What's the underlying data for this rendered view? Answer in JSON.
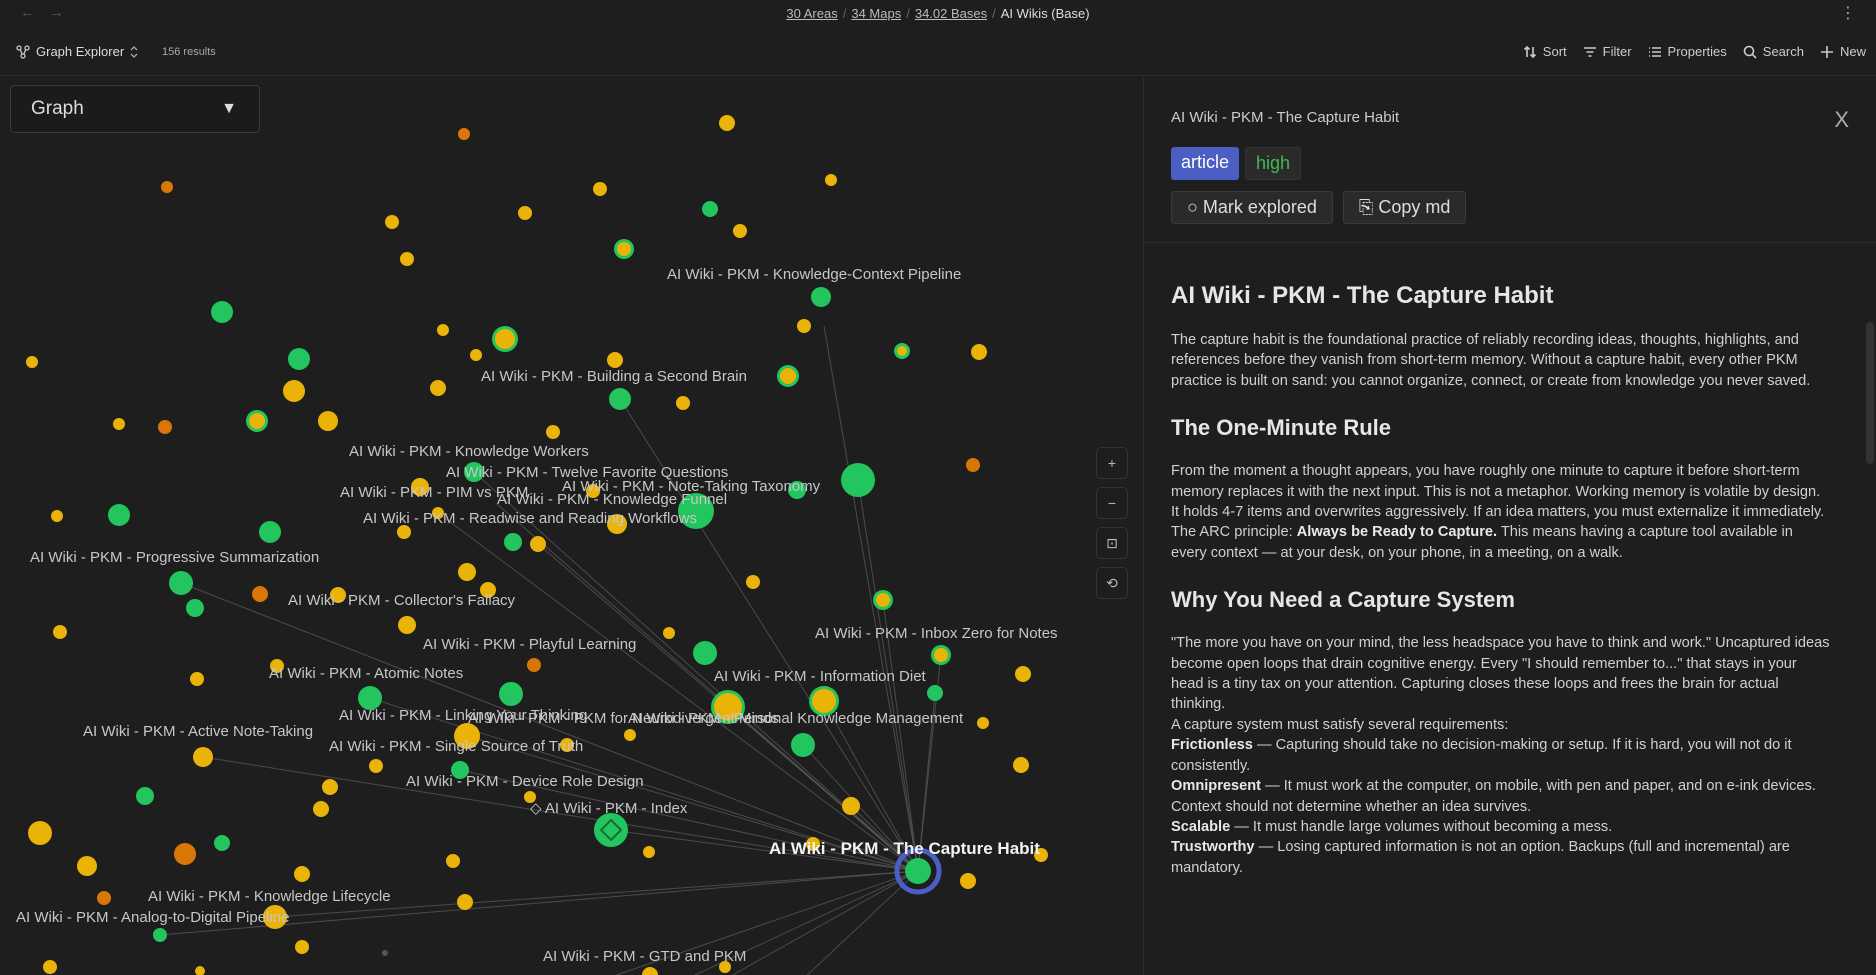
{
  "topbar": {
    "back_arrow": "←",
    "forward_arrow": "→",
    "breadcrumbs": [
      "30 Areas",
      "34 Maps",
      "34.02 Bases"
    ],
    "separator": "/",
    "current": "AI Wikis (Base)",
    "menu_glyph": "⋮"
  },
  "toolbar": {
    "view_name": "Graph Explorer",
    "results": "156 results",
    "sort": "Sort",
    "filter": "Filter",
    "properties": "Properties",
    "search": "Search",
    "new": "New"
  },
  "graph": {
    "selector_value": "Graph",
    "selector_caret": "▼",
    "zoom_in": "+",
    "zoom_out": "−",
    "fit": "⊡",
    "reset": "⟲",
    "active_node": "AI Wiki - PKM - The Capture Habit",
    "index_node": "◇ AI Wiki - PKM - Index",
    "colors": {
      "green": "#22c55e",
      "amber": "#eab308",
      "orange": "#d97706",
      "ring": "#4a5ec4"
    },
    "labels": [
      "AI Wiki - PKM - Knowledge-Context Pipeline",
      "AI Wiki - PKM - Building a Second Brain",
      "AI Wiki - PKM - Knowledge Workers",
      "AI Wiki - PKM - Twelve Favorite Questions",
      "AI Wiki - PKM - PIM vs PKM",
      "AI Wiki - PKM - Note-Taking Taxonomy",
      "AI Wiki - PKM - Knowledge Funnel",
      "AI Wiki - PKM - Readwise and Reading Workflows",
      "AI Wiki - PKM - Progressive Summarization",
      "AI Wiki - PKM - Collector's Fallacy",
      "AI Wiki - PKM - Inbox Zero for Notes",
      "AI Wiki - PKM - Playful Learning",
      "AI Wiki - PKM - Atomic Notes",
      "AI Wiki - PKM - Information Diet",
      "AI Wiki - PKM - Linking Your Thinking",
      "AI Wiki - PKM - PKM for Neurodivergent Minds",
      "AI Wiki - PKM - Personal Knowledge Management",
      "AI Wiki - PKM - Active Note-Taking",
      "AI Wiki - PKM - Single Source of Truth",
      "AI Wiki - PKM - Device Role Design",
      "AI Wiki - PKM - Knowledge Lifecycle",
      "AI Wiki - PKM - Analog-to-Digital Pipeline",
      "AI Wiki - PKM - GTD and PKM"
    ]
  },
  "panel": {
    "title_small": "AI Wiki - PKM - The Capture Habit",
    "close": "X",
    "tags": [
      "article",
      "high"
    ],
    "mark_explored": "○ Mark explored",
    "copy_md": "⎘ Copy md",
    "doc": {
      "h1": "AI Wiki - PKM - The Capture Habit",
      "intro": "The capture habit is the foundational practice of reliably recording ideas, thoughts, highlights, and references before they vanish from short-term memory. Without a capture habit, every other PKM practice is built on sand: you cannot organize, connect, or create from knowledge you never saved.",
      "h2_1": "The One-Minute Rule",
      "p1": "From the moment a thought appears, you have roughly one minute to capture it before short-term memory replaces it with the next input. This is not a metaphor. Working memory is volatile by design. It holds 4-7 items and overwrites aggressively. If an idea matters, you must externalize it immediately.",
      "p2_pre": "The ARC principle: ",
      "p2_bold": "Always be Ready to Capture.",
      "p2_post": " This means having a capture tool available in every context — at your desk, on your phone, in a meeting, on a walk.",
      "h2_2": "Why You Need a Capture System",
      "p3": "\"The more you have on your mind, the less headspace you have to think and work.\" Uncaptured ideas become open loops that drain cognitive energy. Every \"I should remember to...\" that stays in your head is a tiny tax on your attention. Capturing closes these loops and frees the brain for actual thinking.",
      "p4": "A capture system must satisfy several requirements:",
      "req1_b": "Frictionless",
      "req1": " — Capturing should take no decision-making or setup. If it is hard, you will not do it consistently.",
      "req2_b": "Omnipresent",
      "req2": " — It must work at the computer, on mobile, with pen and paper, and on e-ink devices. Context should not determine whether an idea survives.",
      "req3_b": "Scalable",
      "req3": " — It must handle large volumes without becoming a mess.",
      "req4_b": "Trustworthy",
      "req4": " — Losing captured information is not an option. Backups (full and incremental) are mandatory."
    }
  }
}
